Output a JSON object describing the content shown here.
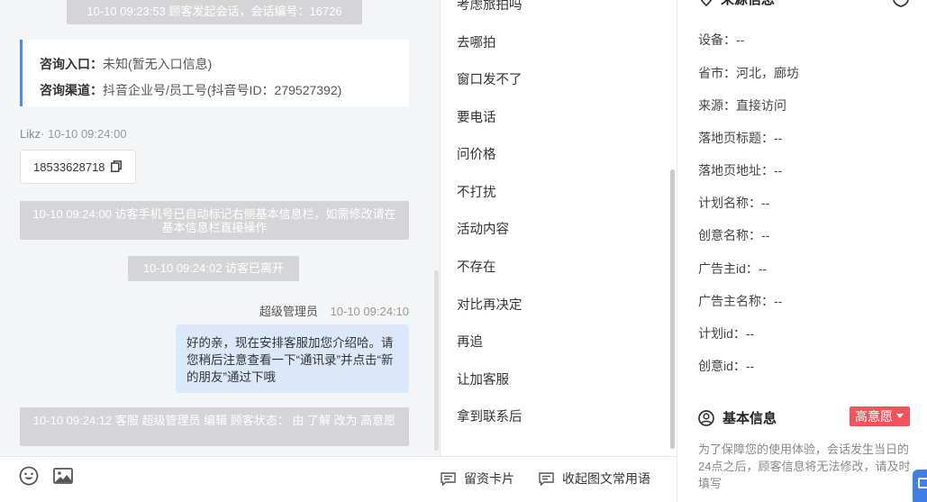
{
  "chat": {
    "sys_start": "10-10 09:23:53 顾客发起会话，会话编号：16726",
    "entry_label": "咨询入口：",
    "entry_value": "未知(暂无入口信息)",
    "channel_label": "咨询渠道：",
    "channel_value": "抖音企业号/员工号(抖音号ID：279527392)",
    "visitor_name": "Likz·",
    "visitor_time": "10-10 09:24:00",
    "phone": "18533628718",
    "sys_phone": "10-10 09:24:00 访客手机号已自动标记右侧基本信息栏，如需修改请在基本信息栏直接操作",
    "sys_leave": "10-10 09:24:02 访客已离开",
    "agent_name": "超级管理员",
    "agent_time": "10-10 09:24:10",
    "agent_message": "好的亲，现在安排客服加您介绍哈。请您稍后注意查看一下“通讯录”并点击“新的朋友”通过下哦",
    "sys_status": "10-10 09:24:12 客服 超级管理员 编辑 顾客状态： 由 了解 改为 高意愿"
  },
  "inputbar": {
    "card_label": "留资卡片",
    "collapse_label": "收起图文常用语"
  },
  "phrases": [
    "考虑旅拍吗",
    "去哪拍",
    "窗口发不了",
    "要电话",
    "问价格",
    "不打扰",
    "活动内容",
    "不存在",
    "对比再决定",
    "再追",
    "让加客服",
    "拿到联系后"
  ],
  "info": {
    "source_title": "来源信息",
    "source_items": [
      "设备：--",
      "省市：河北，廊坊",
      "来源：直接访问",
      "落地页标题：--",
      "落地页地址：--",
      "计划名称：--",
      "创意名称：--",
      "广告主id：--",
      "广告主名称：--",
      "计划id：--",
      "创意id：--"
    ],
    "basic_title": "基本信息",
    "intent": "高意愿",
    "notice": "为了保障您的使用体验，会话发生当日的24点之后，顾客信息将无法修改，请及时填写"
  },
  "colors": {
    "accent": "#4c8bf5",
    "bubble": "#dbe8fc",
    "badge": "#f5535c",
    "system": "#d5d5d7"
  }
}
